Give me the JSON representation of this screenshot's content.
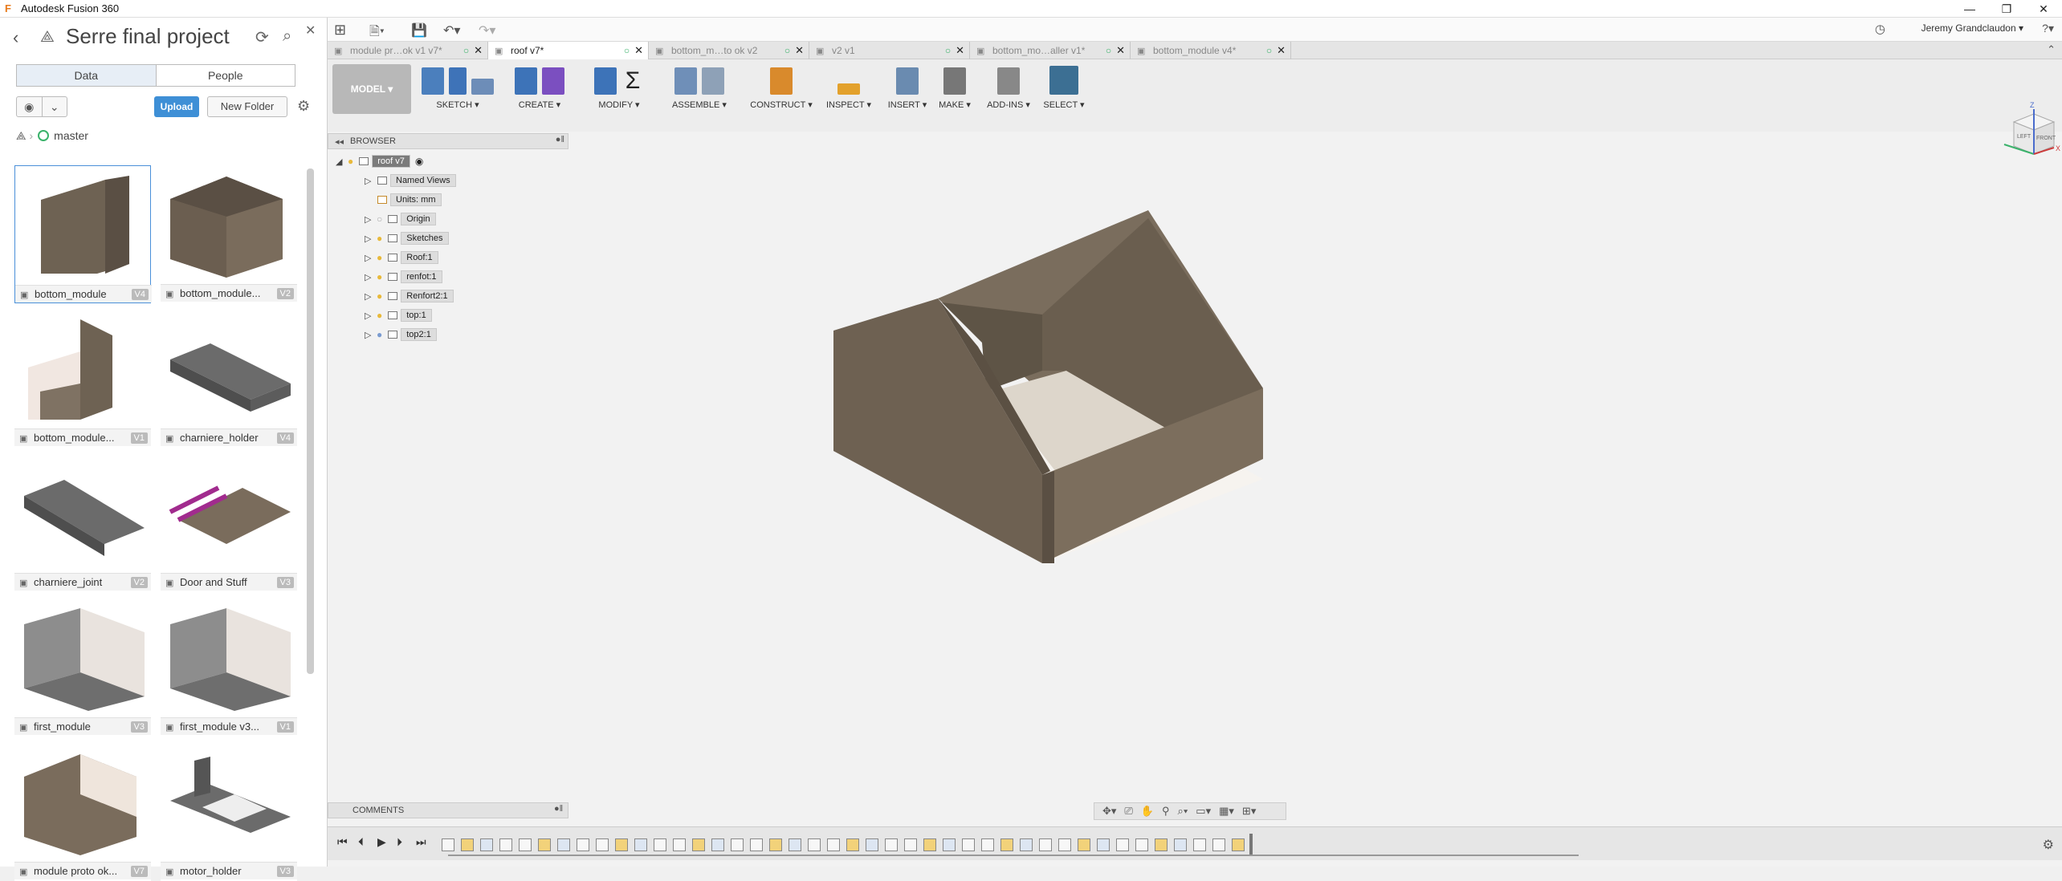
{
  "window": {
    "title": "Autodesk Fusion 360",
    "minimize": "—",
    "restore": "❐",
    "close": "✕"
  },
  "data_panel": {
    "project_title": "Serre final project",
    "tabs": {
      "data": "Data",
      "people": "People"
    },
    "upload_label": "Upload",
    "new_folder_label": "New Folder",
    "breadcrumb": "master",
    "items": [
      {
        "name": "bottom_module",
        "version": "V4"
      },
      {
        "name": "bottom_module...",
        "version": "V2"
      },
      {
        "name": "bottom_module...",
        "version": "V1"
      },
      {
        "name": "charniere_holder",
        "version": "V4"
      },
      {
        "name": "charniere_joint",
        "version": "V2"
      },
      {
        "name": "Door and Stuff",
        "version": "V3"
      },
      {
        "name": "first_module",
        "version": "V3"
      },
      {
        "name": "first_module v3...",
        "version": "V1"
      },
      {
        "name": "module proto ok...",
        "version": "V7"
      },
      {
        "name": "motor_holder",
        "version": "V3"
      }
    ]
  },
  "header": {
    "user": "Jeremy Grandclaudon ▾",
    "help": "?▾"
  },
  "doc_tabs": [
    {
      "label": "module pr…ok v1 v7*"
    },
    {
      "label": "roof v7*",
      "active": true
    },
    {
      "label": "bottom_m…to ok v2"
    },
    {
      "label": "v2 v1"
    },
    {
      "label": "bottom_mo…aller v1*"
    },
    {
      "label": "bottom_module v4*"
    }
  ],
  "ribbon": {
    "workspace": "MODEL ▾",
    "groups": [
      {
        "label": "SKETCH ▾"
      },
      {
        "label": "CREATE ▾"
      },
      {
        "label": "MODIFY ▾"
      },
      {
        "label": "ASSEMBLE ▾"
      },
      {
        "label": "CONSTRUCT ▾"
      },
      {
        "label": "INSPECT ▾"
      },
      {
        "label": "INSERT ▾"
      },
      {
        "label": "MAKE ▾"
      },
      {
        "label": "ADD-INS ▾"
      },
      {
        "label": "SELECT ▾"
      }
    ]
  },
  "browser": {
    "title": "BROWSER",
    "root": "roof v7",
    "nodes": [
      "Named Views",
      "Units: mm",
      "Origin",
      "Sketches",
      "Roof:1",
      "renfot:1",
      "Renfort2:1",
      "top:1",
      "top2:1"
    ]
  },
  "comments": {
    "title": "COMMENTS"
  },
  "viewcube": {
    "top": "Z",
    "left": "LEFT",
    "front": "FRONT",
    "x": "X"
  },
  "colors": {
    "accent": "#3e8fd6",
    "wood": "#6f6354",
    "floor": "#d9d2c7",
    "status": "#3bb26b"
  }
}
